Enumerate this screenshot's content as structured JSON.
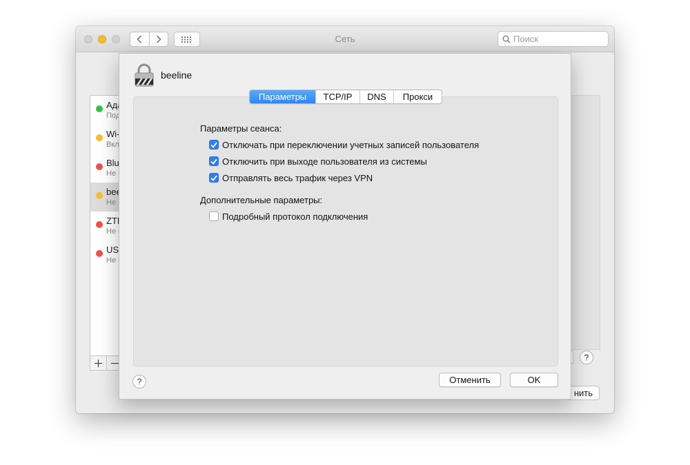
{
  "window": {
    "title": "Сеть",
    "search_placeholder": "Поиск"
  },
  "services": [
    {
      "name": "Адаптер",
      "status": "Подключено",
      "color": "#35c34a"
    },
    {
      "name": "Wi-Fi",
      "status": "Включено",
      "color": "#f6be2f"
    },
    {
      "name": "Bluetooth PAN",
      "status": "Не подключено",
      "color": "#f0514d"
    },
    {
      "name": "beeline",
      "status": "Не подключено",
      "color": "#f6be2f"
    },
    {
      "name": "ZTE",
      "status": "Не подключено",
      "color": "#f0514d"
    },
    {
      "name": "USB",
      "status": "Не подключено",
      "color": "#f0514d"
    }
  ],
  "background": {
    "apply_label": "нить",
    "help_label": "?"
  },
  "sheet": {
    "vpn_name": "beeline",
    "tabs": [
      "Параметры",
      "TCP/IP",
      "DNS",
      "Прокси"
    ],
    "active_tab": "Параметры",
    "session_label": "Параметры сеанса:",
    "session_options": [
      {
        "label": "Отключать при переключении учетных записей пользователя",
        "checked": true
      },
      {
        "label": "Отключить при выходе пользователя из системы",
        "checked": true
      },
      {
        "label": "Отправлять весь трафик через VPN",
        "checked": true
      }
    ],
    "advanced_label": "Дополнительные параметры:",
    "advanced_options": [
      {
        "label": "Подробный протокол подключения",
        "checked": false
      }
    ],
    "help_label": "?",
    "cancel_label": "Отменить",
    "ok_label": "OK"
  },
  "colors": {
    "accent": "#2f7ff2",
    "minimize": "#f6be2f"
  }
}
